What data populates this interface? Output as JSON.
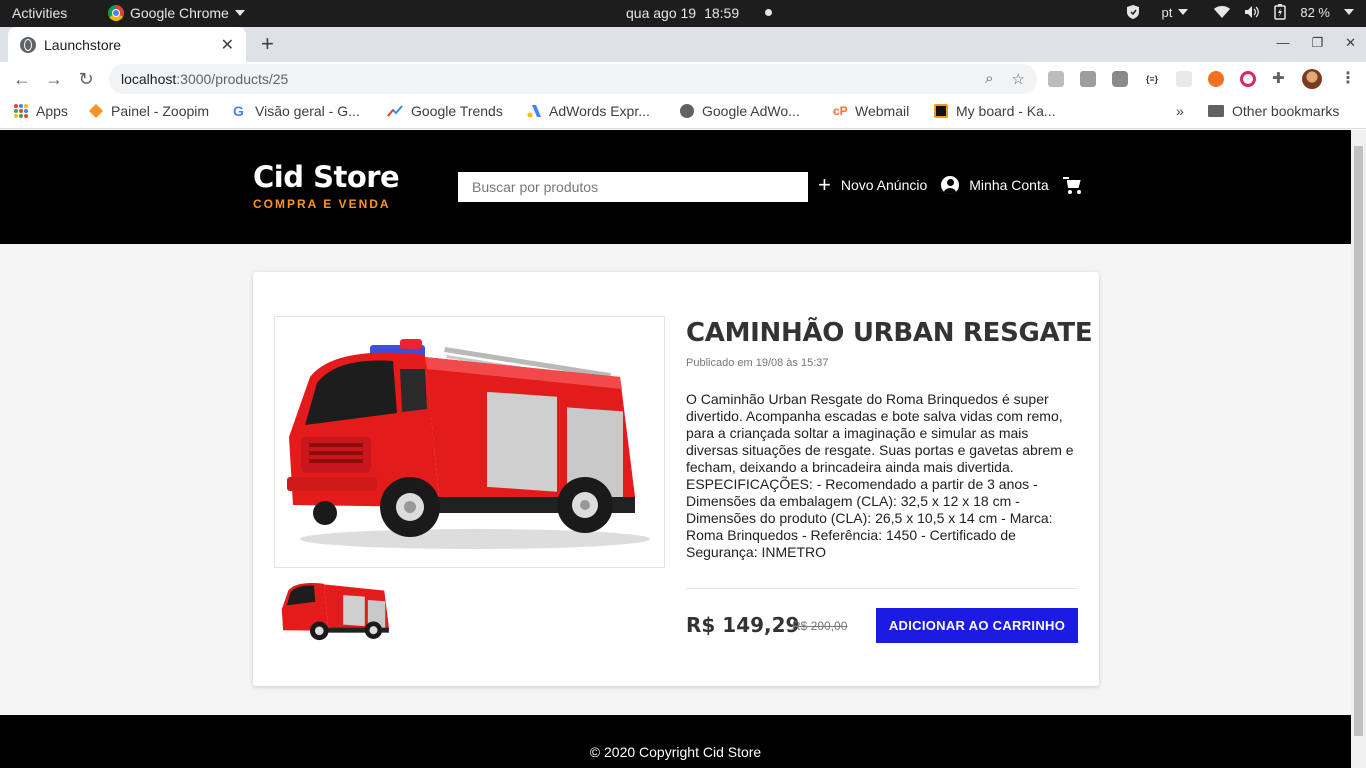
{
  "gnome": {
    "activities": "Activities",
    "app_name": "Google Chrome",
    "date": "qua ago 19",
    "time": "18:59",
    "keyboard_lang": "pt",
    "battery": "82 %"
  },
  "browser": {
    "tab_title": "Launchstore",
    "url_host": "localhost",
    "url_path": ":3000/products/25",
    "bookmarks": [
      {
        "label": "Apps"
      },
      {
        "label": "Painel - Zoopim"
      },
      {
        "label": "Visão geral - G..."
      },
      {
        "label": "Google Trends"
      },
      {
        "label": "AdWords Expr..."
      },
      {
        "label": "Google AdWo..."
      },
      {
        "label": "Webmail"
      },
      {
        "label": "My board - Ka..."
      }
    ],
    "overflow": "»",
    "other_bookmarks": "Other bookmarks"
  },
  "site": {
    "logo_title": "Cid Store",
    "logo_subtitle": "COMPRA E VENDA",
    "search_placeholder": "Buscar por produtos",
    "nav_new_ad": "Novo Anúncio",
    "nav_account": "Minha Conta"
  },
  "product": {
    "name": "CAMINHÃO URBAN RESGATE",
    "published": "Publicado em 19/08 às 15:37",
    "description": "O Caminhão Urban Resgate do Roma Brinquedos é super divertido. Acompanha escadas e bote salva vidas com remo, para a criançada soltar a imaginação e simular as mais diversas situações de resgate. Suas portas e gavetas abrem e fecham, deixando a brincadeira ainda mais divertida. ESPECIFICAÇÕES: - Recomendado a partir de 3 anos - Dimensões da embalagem (CLA): 32,5 x 12 x 18 cm - Dimensões do produto (CLA): 26,5 x 10,5 x 14 cm - Marca: Roma Brinquedos - Referência: 1450 - Certificado de Segurança: INMETRO",
    "price": "R$ 149,29",
    "old_price": "R$ 200,00",
    "buy_label": "ADICIONAR AO CARRINHO"
  },
  "footer": {
    "copyright": "© 2020 Copyright Cid Store"
  },
  "colors": {
    "accent_orange": "#fd951f",
    "button_blue": "#1b1be3",
    "truck_red": "#e31b1b"
  }
}
